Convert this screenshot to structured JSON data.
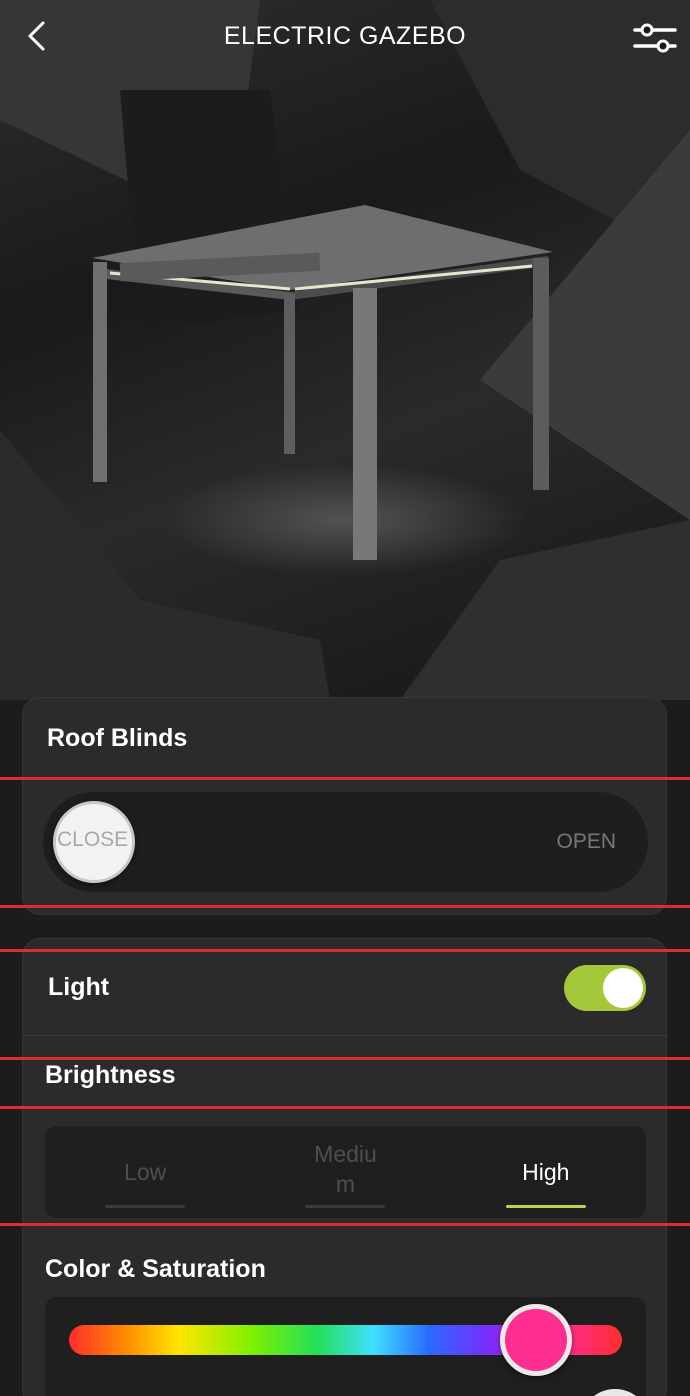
{
  "header": {
    "title": "ELECTRIC GAZEBO",
    "back_icon": "chevron-left-icon",
    "settings_icon": "sliders-icon"
  },
  "roof_blinds": {
    "title": "Roof Blinds",
    "close_label": "CLOSE",
    "open_label": "OPEN",
    "position": 0
  },
  "light": {
    "title": "Light",
    "enabled": true,
    "toggle_color": "#a5c83a"
  },
  "brightness": {
    "title": "Brightness",
    "options": [
      "Low",
      "Mediu m",
      "High"
    ],
    "selected": "High",
    "accent_color": "#b9d645"
  },
  "color_saturation": {
    "title": "Color & Saturation",
    "selected_color": "#ff2e93",
    "hue_position": 0.86
  }
}
